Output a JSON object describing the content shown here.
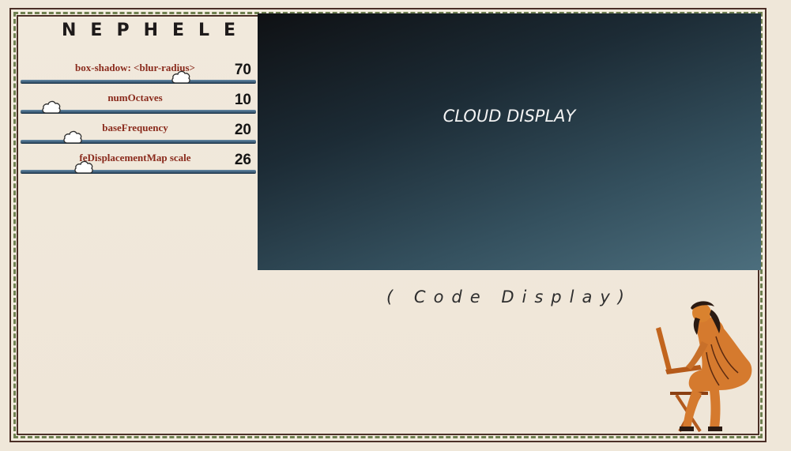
{
  "app": {
    "logo_text": "NEPHELE"
  },
  "sliders": [
    {
      "label": "box-shadow: <blur-radius>",
      "value": "70",
      "fraction": 0.68
    },
    {
      "label": "numOctaves",
      "value": "10",
      "fraction": 0.13
    },
    {
      "label": "baseFrequency",
      "value": "20",
      "fraction": 0.22
    },
    {
      "label": "feDisplacementMap scale",
      "value": "26",
      "fraction": 0.27
    }
  ],
  "cloud_display": {
    "title": "CLOUD DISPLAY"
  },
  "code_display": {
    "text": "( Code Display)"
  },
  "colors": {
    "label_red": "#8a2b1d",
    "track_blue": "#2b4a63",
    "panel_dark": "#0f1114",
    "panel_light": "#4c6e7d",
    "frame_brown": "#4b2f26",
    "vine_green": "#6f8050"
  },
  "icons": {
    "slider_thumb": "cloud-icon",
    "figure": "greek-figure-with-laptop"
  }
}
